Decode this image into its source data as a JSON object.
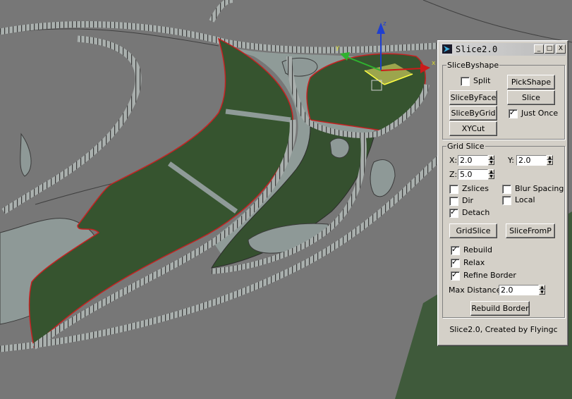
{
  "window": {
    "title": "Slice2.0",
    "controls": {
      "minimize": "_",
      "maximize": "□",
      "close": "X"
    }
  },
  "viewport": {
    "axis_labels": {
      "x": "x",
      "y": "y",
      "z": "z"
    },
    "colors": {
      "background": "#777777",
      "grass": "#36542f",
      "paving": "#8f9b98",
      "border": "#d21a1a",
      "curb": "#4a4a4a"
    }
  },
  "slice_by_shape": {
    "legend": "SliceByshape",
    "split": {
      "label": "Split",
      "checked": false
    },
    "pick_shape": "PickShape",
    "slice_by_face": "SliceByFace",
    "slice": "Slice",
    "slice_by_grid": "SliceByGrid",
    "just_once": {
      "label": "Just Once",
      "checked": true
    },
    "xy_cut": "XYCut"
  },
  "grid_slice": {
    "legend": "Grid Slice",
    "x": {
      "label": "X:",
      "value": "2.0"
    },
    "y": {
      "label": "Y:",
      "value": "2.0"
    },
    "z": {
      "label": "Z:",
      "value": "5.0"
    },
    "zslices": {
      "label": "Zslices",
      "checked": false
    },
    "blur_spacing": {
      "label": "Blur Spacing",
      "checked": false
    },
    "dir": {
      "label": "Dir",
      "checked": false
    },
    "local": {
      "label": "Local",
      "checked": false
    },
    "detach": {
      "label": "Detach",
      "checked": true
    },
    "grid_slice_btn": "GridSlice",
    "slice_from_p": "SliceFromP"
  },
  "options": {
    "rebuild": {
      "label": "Rebuild",
      "checked": true
    },
    "relax": {
      "label": "Relax",
      "checked": true
    },
    "refine_border": {
      "label": "Refine Border",
      "checked": true
    },
    "max_distance": {
      "label": "Max Distance:",
      "value": "2.0"
    },
    "rebuild_border": "Rebuild Border"
  },
  "credit": "Slice2.0, Created by Flyingc"
}
